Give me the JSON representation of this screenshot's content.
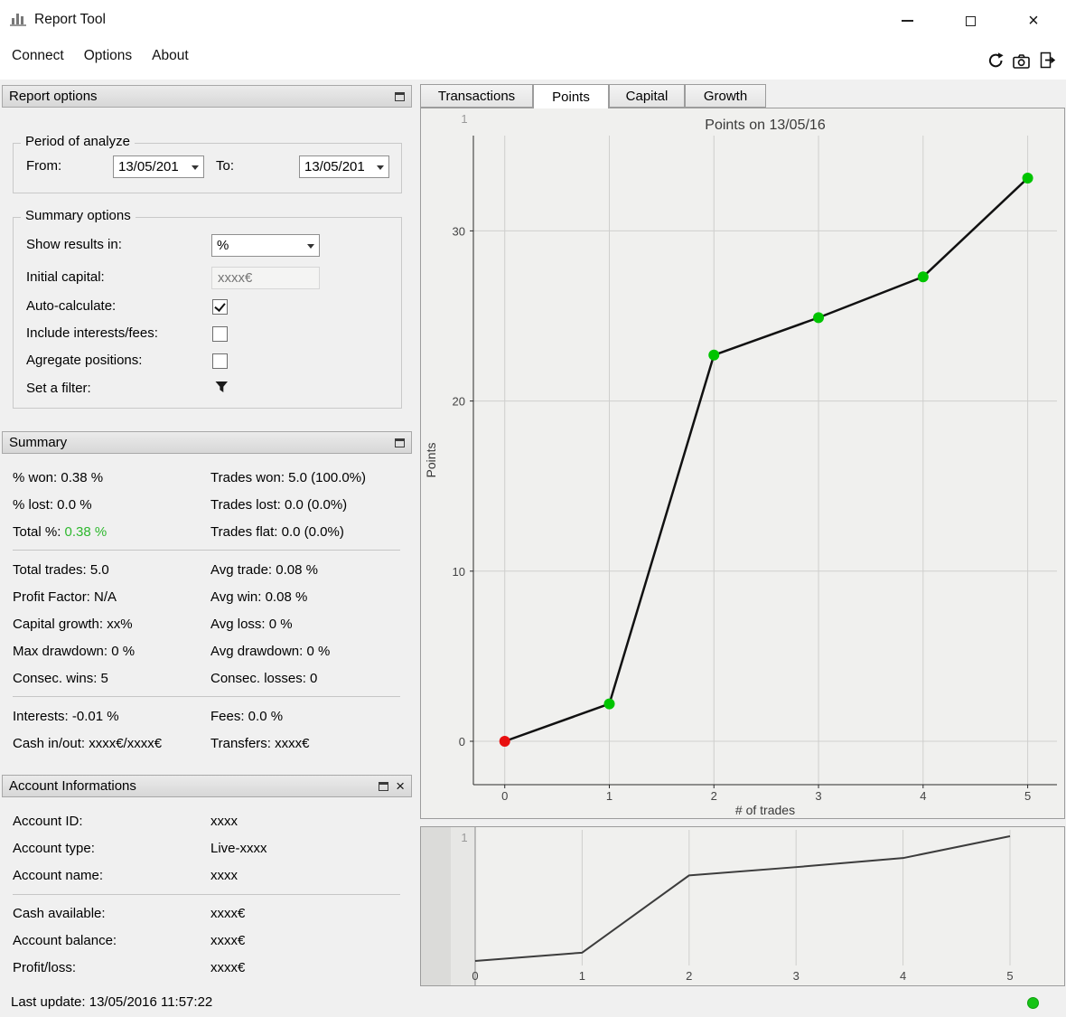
{
  "window": {
    "title": "Report Tool"
  },
  "menu": {
    "connect": "Connect",
    "options": "Options",
    "about": "About"
  },
  "report_options": {
    "title": "Report options",
    "period": {
      "title": "Period of analyze",
      "from_label": "From:",
      "from_value": "13/05/201",
      "to_label": "To:",
      "to_value": "13/05/201"
    },
    "summary_options": {
      "title": "Summary options",
      "show_results_label": "Show results in:",
      "show_results_value": "%",
      "initial_capital_label": "Initial capital:",
      "initial_capital_placeholder": "xxxx€",
      "auto_calculate_label": "Auto-calculate:",
      "include_label": "Include interests/fees:",
      "agregate_label": "Agregate positions:",
      "filter_label": "Set a filter:"
    }
  },
  "summary": {
    "title": "Summary",
    "group1": [
      {
        "left": "% won: 0.38 %",
        "right": "Trades won: 5.0 (100.0%)"
      },
      {
        "left": "% lost: 0.0 %",
        "right": "Trades lost: 0.0 (0.0%)"
      },
      {
        "left_label": "Total %:",
        "left_value": "0.38 %",
        "right": "Trades flat: 0.0 (0.0%)"
      }
    ],
    "group2": [
      {
        "left": "Total trades: 5.0",
        "right": "Avg trade: 0.08 %"
      },
      {
        "left": "Profit Factor: N/A",
        "right": "Avg win: 0.08 %"
      },
      {
        "left": "Capital growth: xx%",
        "right": "Avg loss: 0 %"
      },
      {
        "left": "Max drawdown: 0 %",
        "right": "Avg drawdown: 0 %"
      },
      {
        "left": "Consec. wins: 5",
        "right": "Consec. losses: 0"
      }
    ],
    "group3": [
      {
        "left": "Interests: -0.01 %",
        "right": "Fees: 0.0 %"
      },
      {
        "left": "Cash in/out: xxxx€/xxxx€",
        "right": "Transfers: xxxx€"
      }
    ]
  },
  "account": {
    "title": "Account Informations",
    "group1": [
      {
        "label": "Account ID:",
        "value": "xxxx"
      },
      {
        "label": "Account type:",
        "value": "Live-xxxx"
      },
      {
        "label": "Account name:",
        "value": "xxxx"
      }
    ],
    "group2": [
      {
        "label": "Cash available:",
        "value": "xxxx€"
      },
      {
        "label": "Account balance:",
        "value": "xxxx€"
      },
      {
        "label": "Profit/loss:",
        "value": "xxxx€"
      }
    ]
  },
  "tabs": {
    "transactions": "Transactions",
    "points": "Points",
    "capital": "Capital",
    "growth": "Growth",
    "active": "Points"
  },
  "statusbar": {
    "last_update": "Last update: 13/05/2016 11:57:22",
    "status_color": "#17c417"
  },
  "chart_data": [
    {
      "type": "line",
      "title": "Points on 13/05/16",
      "xlabel": "# of trades",
      "ylabel": "Points",
      "x": [
        0,
        1,
        2,
        3,
        4,
        5
      ],
      "y": [
        0,
        2.2,
        22.7,
        24.9,
        27.3,
        33.1
      ],
      "xticks": [
        0,
        1,
        2,
        3,
        4,
        5
      ],
      "yticks": [
        0,
        10,
        20,
        30
      ],
      "xlim": [
        -0.3,
        5.28
      ],
      "ylim": [
        -2.55,
        35.6
      ],
      "grid": true,
      "line_color": "#111111",
      "marker_colors": [
        "#e81010",
        "#00c400",
        "#00c400",
        "#00c400",
        "#00c400",
        "#00c400"
      ],
      "corner_labels": [
        "0",
        "1"
      ]
    },
    {
      "type": "line",
      "role": "overview",
      "x": [
        0,
        1,
        2,
        3,
        4,
        5
      ],
      "y": [
        0,
        2.2,
        22.7,
        24.9,
        27.3,
        33.1
      ],
      "xticks": [
        0,
        1,
        2,
        3,
        4,
        5
      ],
      "xlim": [
        0,
        5
      ],
      "ylim": [
        0,
        33.1
      ],
      "grid": true,
      "line_color": "#3c3c3c",
      "corner_labels": [
        "0",
        "1"
      ]
    }
  ]
}
